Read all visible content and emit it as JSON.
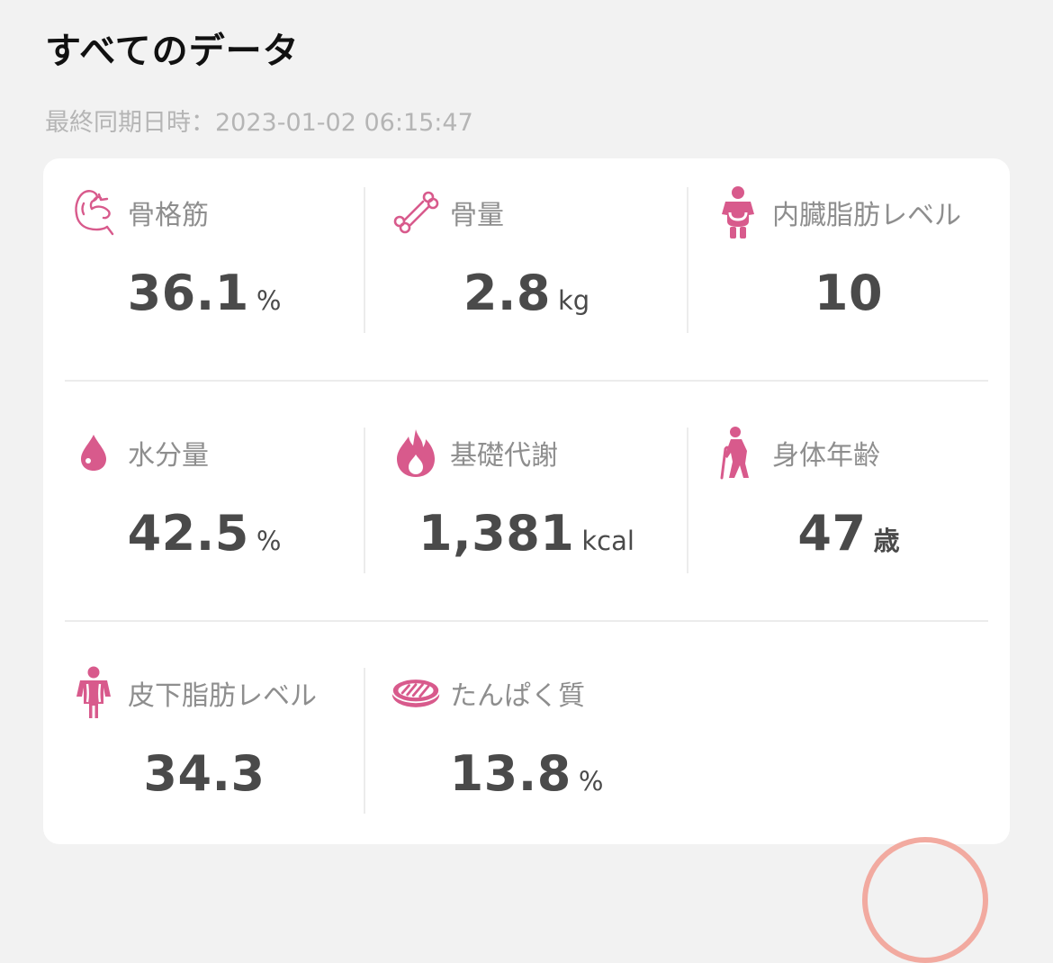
{
  "header": {
    "title": "すべてのデータ",
    "sync_label": "最終同期日時：",
    "sync_value": "2023-01-02 06:15:47"
  },
  "accent_color": "#d85a8c",
  "metrics": [
    {
      "label": "骨格筋",
      "icon": "muscle-icon",
      "value": "36.1",
      "unit": "%"
    },
    {
      "label": "骨量",
      "icon": "bone-icon",
      "value": "2.8",
      "unit": "kg"
    },
    {
      "label": "内臓脂肪レベル",
      "icon": "visceral-fat-icon",
      "value": "10",
      "unit": ""
    },
    {
      "label": "水分量",
      "icon": "water-drop-icon",
      "value": "42.5",
      "unit": "%"
    },
    {
      "label": "基礎代謝",
      "icon": "flame-icon",
      "value": "1,381",
      "unit": "kcal"
    },
    {
      "label": "身体年齢",
      "icon": "elderly-person-icon",
      "value": "47",
      "unit": "歳"
    },
    {
      "label": "皮下脂肪レベル",
      "icon": "subcutaneous-fat-icon",
      "value": "34.3",
      "unit": ""
    },
    {
      "label": "たんぱく質",
      "icon": "steak-icon",
      "value": "13.8",
      "unit": "%"
    }
  ]
}
